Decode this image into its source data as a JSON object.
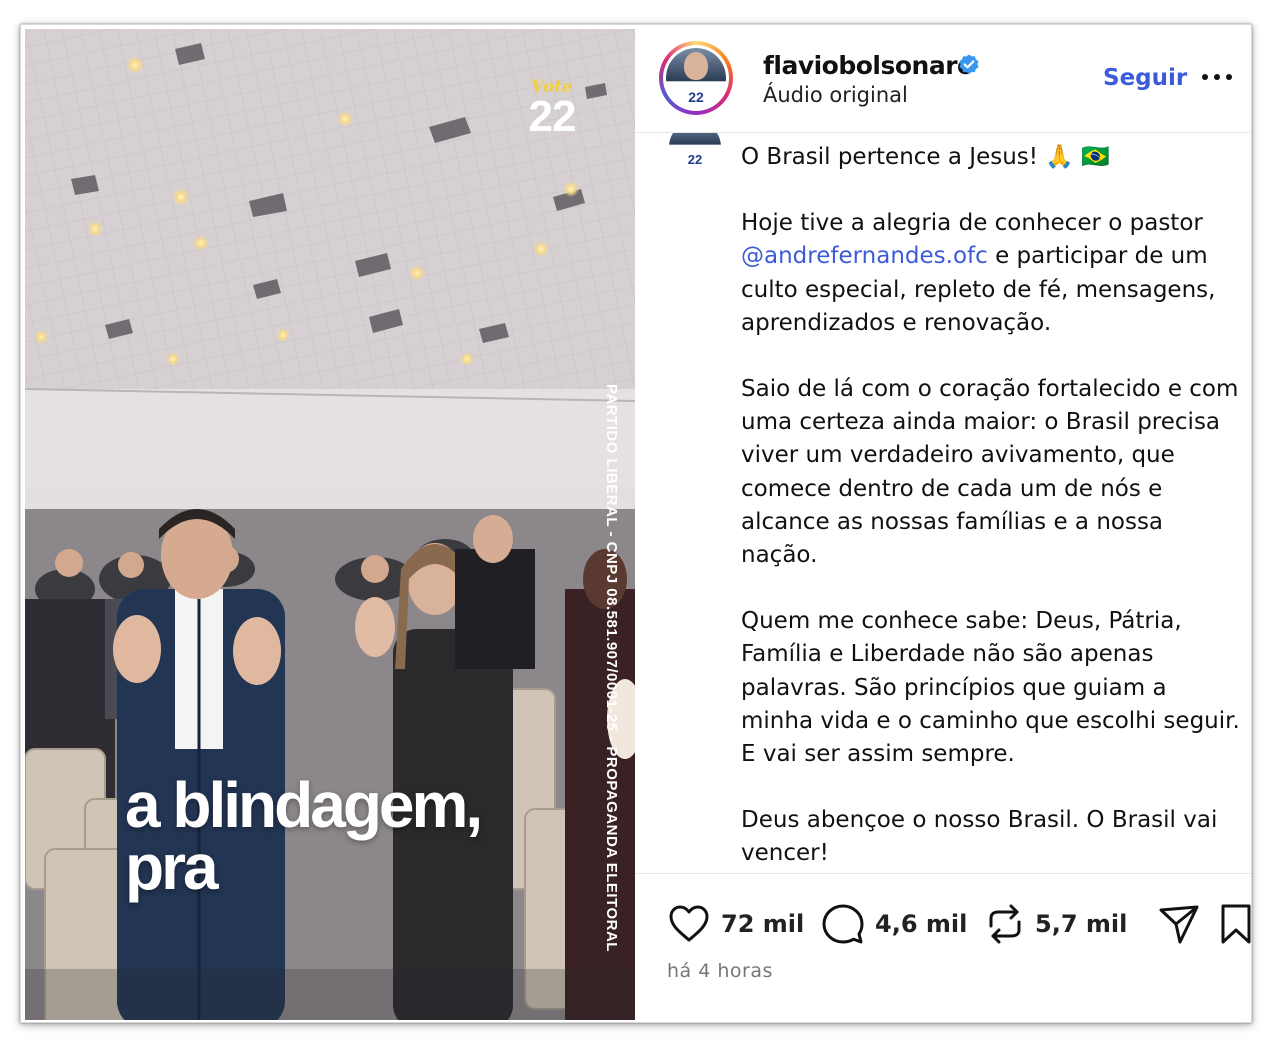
{
  "media": {
    "vote_script": "Vote",
    "vote_number": "22",
    "vertical_text": "PARTIDO LIBERAL - CNPJ 08.581.907/0001-25 - PROPAGANDA ELEITORAL",
    "caption_line1": "a blindagem,",
    "caption_line2": "pra"
  },
  "header": {
    "avatar_number": "22",
    "username": "flaviobolsonaro",
    "subtitle": "Áudio original",
    "follow_label": "Seguir",
    "more_icon": "more-horizontal-icon",
    "verified_color": "#3897f0"
  },
  "post": {
    "avatar_number": "22",
    "line1": "O Brasil pertence a Jesus! 🙏 🇧🇷",
    "p2_before": "Hoje tive a alegria de conhecer o pastor",
    "p2_mention": "@andrefernandes.ofc",
    "p2_after": "e participar de um culto especial, repleto de fé, mensagens, aprendizados e renovação.",
    "p3": "Saio de lá com o coração fortalecido e com uma certeza ainda maior: o Brasil precisa viver um verdadeiro avivamento, que comece dentro de cada um de nós e alcance as nossas famílias e a nossa nação.",
    "p4": "Quem me conhece sabe: Deus, Pátria, Família e Liberdade não são apenas palavras. São princípios que guiam a minha vida e o caminho que escolhi seguir. E vai ser assim sempre.",
    "p5": "Deus abençoe o nosso Brasil. O Brasil vai vencer!"
  },
  "actions": {
    "likes": "72 mil",
    "comments": "4,6 mil",
    "reposts": "5,7 mil",
    "icons": [
      "heart-icon",
      "comment-icon",
      "repost-icon",
      "share-icon",
      "bookmark-icon"
    ]
  },
  "timestamp": "há 4 horas",
  "colors": {
    "link": "#3c5bd9",
    "vote_yellow": "#f3cf3a"
  }
}
